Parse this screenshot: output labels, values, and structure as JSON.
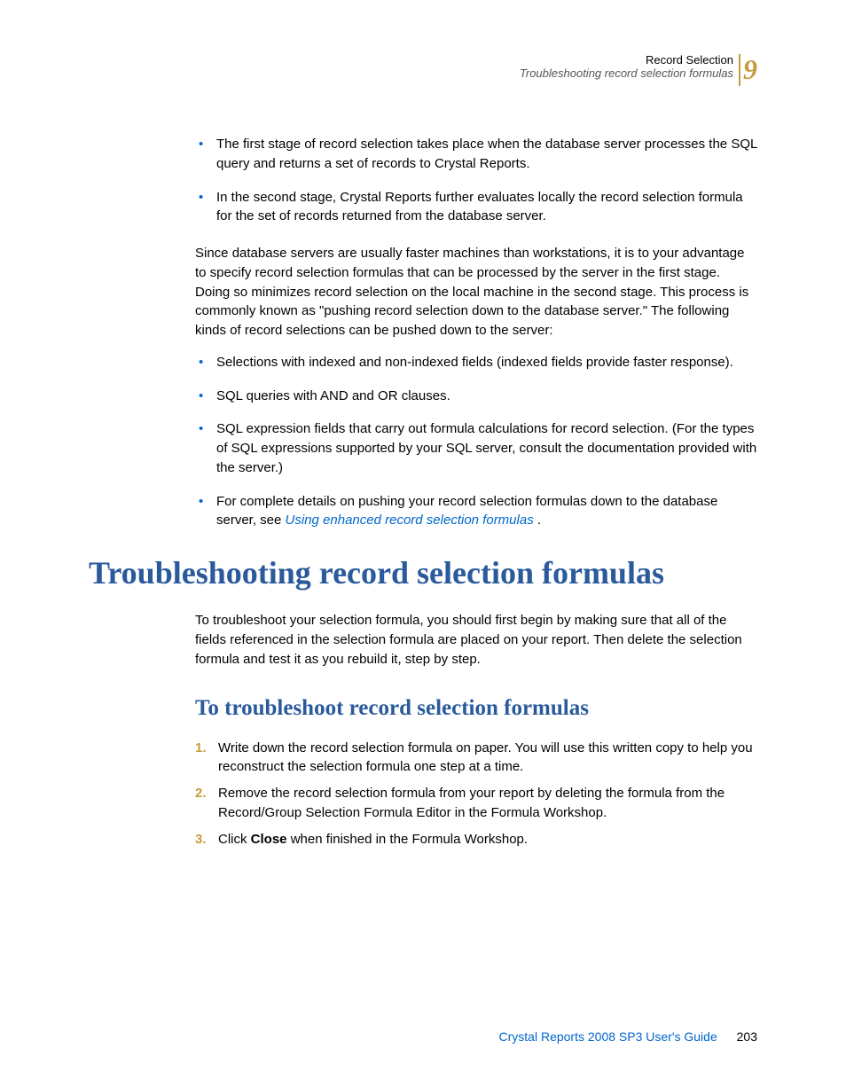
{
  "header": {
    "title": "Record Selection",
    "subtitle": "Troubleshooting record selection formulas",
    "chapter": "9"
  },
  "topBullets": [
    "The first stage of record selection takes place when the database server processes the SQL query and returns a set of records to Crystal Reports.",
    "In the second stage, Crystal Reports further evaluates locally the record selection formula for the set of records returned from the database server."
  ],
  "para1": "Since database servers are usually faster machines than workstations, it is to your advantage to specify record selection formulas that can be processed by the server in the first stage. Doing so minimizes record selection on the local machine in the second stage. This process is commonly known as \"pushing record selection down to the database server.\" The following kinds of record selections can be pushed down to the server:",
  "midBullets": [
    "Selections with indexed and non-indexed fields (indexed fields provide faster response).",
    "SQL queries with AND and OR clauses.",
    "SQL expression fields that carry out formula calculations for record selection. (For the types of SQL expressions supported by your SQL server, consult the documentation provided with the server.)"
  ],
  "lastBullet": {
    "prefix": "For complete details on pushing your record selection formulas down to the database server, see ",
    "link": "Using enhanced record selection formulas",
    "suffix": " ."
  },
  "h1": "Troubleshooting record selection formulas",
  "para2": "To troubleshoot your selection formula, you should first begin by making sure that all of the fields referenced in the selection formula are placed on your report. Then delete the selection formula and test it as you rebuild it, step by step.",
  "h2": "To troubleshoot record selection formulas",
  "steps": [
    {
      "n": "1.",
      "text": "Write down the record selection formula on paper. You will use this written copy to help you reconstruct the selection formula one step at a time."
    },
    {
      "n": "2.",
      "text": "Remove the record selection formula from your report by deleting the formula from the Record/Group Selection Formula Editor in the Formula Workshop."
    },
    {
      "n": "3.",
      "prefix": "Click ",
      "bold": "Close",
      "suffix": " when finished in the Formula Workshop."
    }
  ],
  "footer": {
    "guide": "Crystal Reports 2008 SP3 User's Guide",
    "page": "203"
  }
}
